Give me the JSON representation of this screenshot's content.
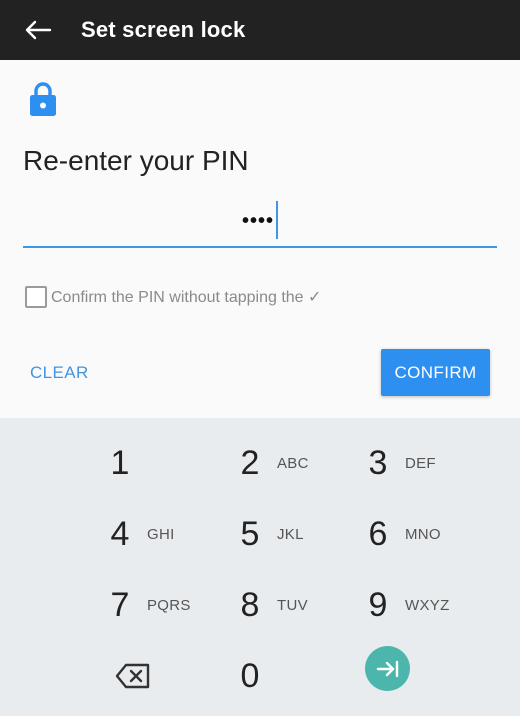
{
  "appbar": {
    "title": "Set screen lock",
    "back_icon": "arrow-left-icon"
  },
  "lock_icon": "lock-icon",
  "accent_color": "#3f97e1",
  "prompt": "Re-enter your PIN",
  "pin_field": {
    "masked_value": "••••"
  },
  "confirm_option": {
    "label": "Confirm the PIN without tapping the ✓",
    "checked": false
  },
  "actions": {
    "clear_label": "CLEAR",
    "confirm_label": "CONFIRM"
  },
  "keypad": {
    "keys": [
      {
        "digit": "1",
        "letters": ""
      },
      {
        "digit": "2",
        "letters": "ABC"
      },
      {
        "digit": "3",
        "letters": "DEF"
      },
      {
        "digit": "4",
        "letters": "GHI"
      },
      {
        "digit": "5",
        "letters": "JKL"
      },
      {
        "digit": "6",
        "letters": "MNO"
      },
      {
        "digit": "7",
        "letters": "PQRS"
      },
      {
        "digit": "8",
        "letters": "TUV"
      },
      {
        "digit": "9",
        "letters": "WXYZ"
      },
      {
        "digit": "0",
        "letters": ""
      }
    ],
    "backspace_icon": "backspace-icon",
    "enter_icon": "next-arrow-icon",
    "enter_color": "#4db6ac"
  }
}
